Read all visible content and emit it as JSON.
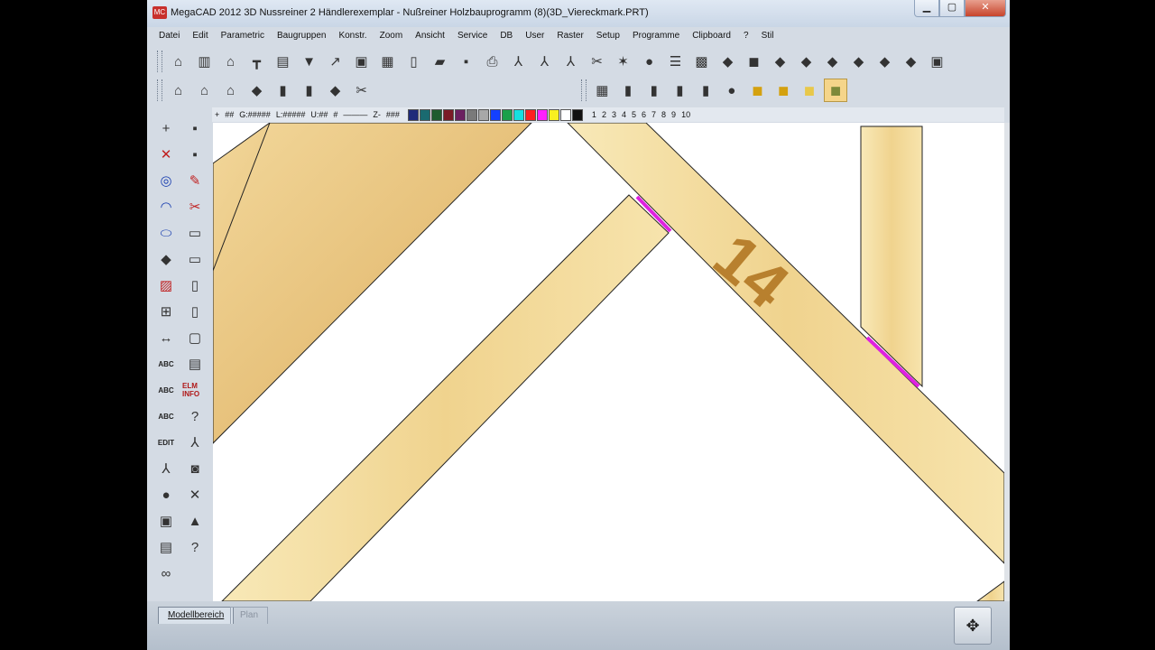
{
  "window": {
    "title": "MegaCAD 2012 3D Nussreiner 2  Händlerexemplar - Nußreiner Holzbauprogramm (8)(3D_Viereckmark.PRT)",
    "minimize": "▁",
    "maximize": "▢",
    "close": "✕"
  },
  "menu": [
    "Datei",
    "Edit",
    "Parametric",
    "Baugruppen",
    "Konstr.",
    "Zoom",
    "Ansicht",
    "Service",
    "DB",
    "User",
    "Raster",
    "Setup",
    "Programme",
    "Clipboard",
    "?",
    "Stil"
  ],
  "toolbar_main": [
    "house-icon",
    "grid-icon",
    "roof-icon",
    "beam-icon",
    "list-icon",
    "arrow-down-icon",
    "curve-icon",
    "frame-icon",
    "wall-icon",
    "new-file-icon",
    "open-folder-icon",
    "save-prt-icon",
    "print-icon",
    "axes-icon",
    "axes-color-icon",
    "axes-tree-icon",
    "scissors-icon",
    "origin-icon",
    "sphere-icon",
    "stack-icon",
    "lg-icon",
    "block-icon",
    "box-icon",
    "box2-icon",
    "box3-icon",
    "box4-icon",
    "box5-icon",
    "box6-icon",
    "box7-icon",
    "box8-icon"
  ],
  "toolbar_second": [
    "roof-red-icon",
    "roof-edit-icon",
    "roof-gable-icon",
    "cube-icon",
    "cylinder-icon",
    "pillar-icon",
    "extrude-icon",
    "cut-icon"
  ],
  "toolbar_render": [
    "mesh-icon",
    "cylinder-gray-icon",
    "cylinder-red-icon",
    "cylinder-lines-icon",
    "cylinder-dark-icon",
    "ogl-sphere-icon",
    "yellow-cube-icon",
    "yellow-cube-star-icon",
    "yellow-cube-light-icon",
    "yellow-cube-selected-icon"
  ],
  "status": {
    "items": [
      "+",
      "##",
      "G:#####",
      "L:#####",
      "U:##",
      "#",
      "Z-",
      "###"
    ],
    "numbers": [
      "1",
      "2",
      "3",
      "4",
      "5",
      "6",
      "7",
      "8",
      "9",
      "10"
    ],
    "palette": [
      "#1f2a7a",
      "#1a6a70",
      "#1e5c2e",
      "#7a1a26",
      "#6b2060",
      "#7a7a7a",
      "#a8a8a8",
      "#1440ff",
      "#1aa04a",
      "#17e0e0",
      "#ff2020",
      "#ff20ff",
      "#f8f020",
      "#ffffff",
      "#111111"
    ]
  },
  "left_tools_1": [
    "plus-icon",
    "cross-lines-icon",
    "circle-icon",
    "arc-icon",
    "ellipse-icon",
    "solid-cube-icon",
    "hatch-icon",
    "dim-icon",
    "measure-icon",
    "text-abc-icon",
    "text-box-icon",
    "text-edit-icon",
    "axes-3d-icon",
    "ogl-icon",
    "image-icon",
    "doc-icon",
    "chain-icon"
  ],
  "left_tools_2": [
    "save-disk-icon",
    "disk-multi-icon",
    "eraser-icon",
    "scissors-red-icon",
    "monitor-icon",
    "monitor2-icon",
    "page-l-icon",
    "page-6-icon",
    "dotted-frame-icon",
    "database-icon",
    "elm-info-text",
    "query-icon",
    "axis-move-icon",
    "camera-icon",
    "arrows-icon",
    "triangle-icon",
    "distance-icon"
  ],
  "left_labels": {
    "edit": "EDIT",
    "elm": "ELM INFO"
  },
  "canvas": {
    "label": "14"
  },
  "tabs": {
    "model": "Modellbereich",
    "plan": "Plan"
  }
}
